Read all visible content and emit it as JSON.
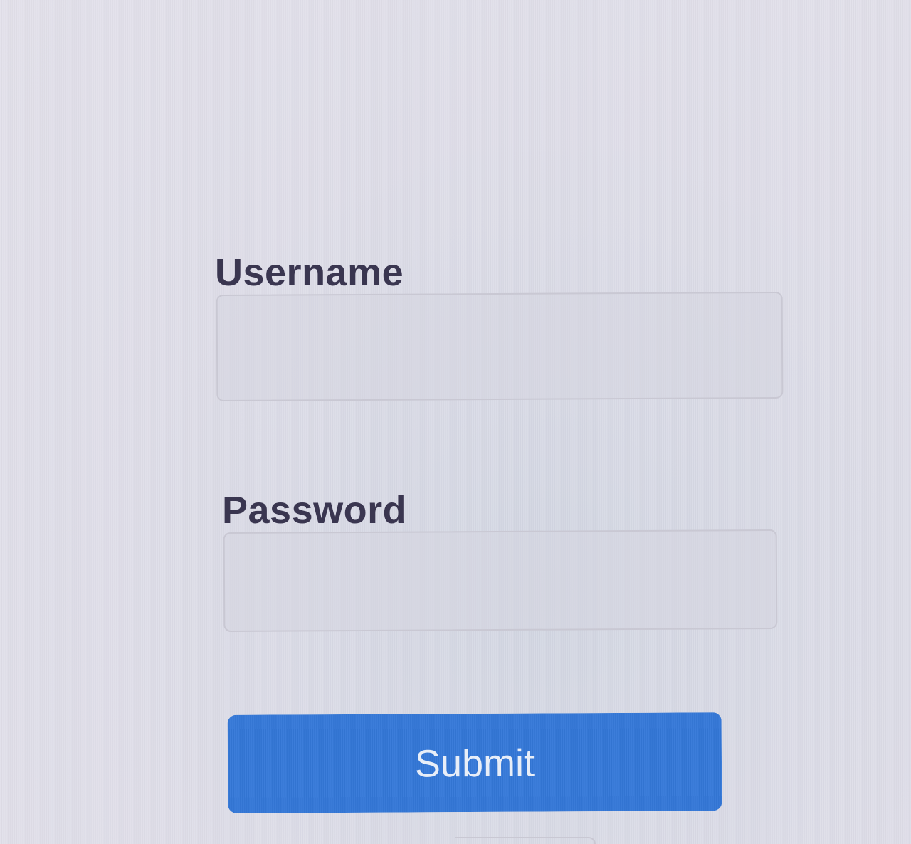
{
  "form": {
    "username": {
      "label": "Username",
      "value": "",
      "placeholder": ""
    },
    "password": {
      "label": "Password",
      "value": "",
      "placeholder": ""
    },
    "submit_label": "Submit"
  },
  "colors": {
    "background": "#dcdbe6",
    "label_text": "#3a3650",
    "field_border": "#c9c8d3",
    "button_background": "#3478d8",
    "button_text": "#e8eef8"
  }
}
